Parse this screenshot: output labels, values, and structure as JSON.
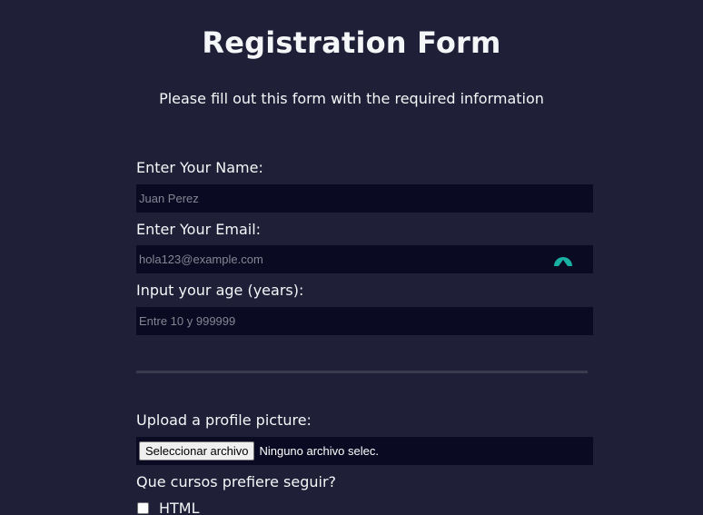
{
  "header": {
    "title": "Registration Form",
    "description": "Please fill out this form with the required information"
  },
  "form": {
    "name": {
      "label": "Enter Your Name:",
      "placeholder": "Juan Perez",
      "value": ""
    },
    "email": {
      "label": "Enter Your Email:",
      "placeholder": "hola123@example.com",
      "value": "",
      "icon": "password-manager-icon"
    },
    "age": {
      "label": "Input your age (years):",
      "placeholder": "Entre 10 y 999999",
      "value": ""
    },
    "profile_picture": {
      "label": "Upload a profile picture:",
      "button_label": "Seleccionar archivo",
      "status": "Ninguno archivo selec."
    },
    "courses": {
      "label": "Que cursos prefiere seguir?",
      "options": [
        {
          "label": "HTML",
          "checked": false
        }
      ]
    }
  },
  "colors": {
    "background": "#1f1f38",
    "field_background": "#0a0a23",
    "text": "#f5f6f7",
    "placeholder": "#858592",
    "divider": "#3b3b4f",
    "icon_accent": "#1ab1a5"
  }
}
